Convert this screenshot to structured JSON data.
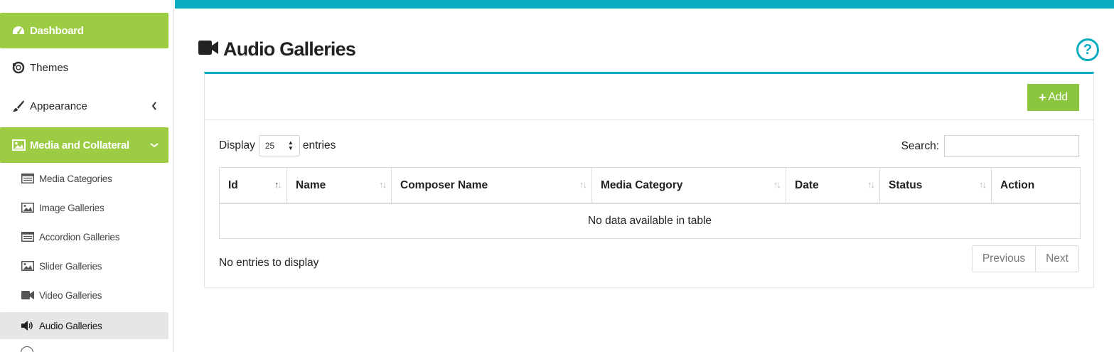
{
  "sidebar": {
    "items": [
      {
        "label": "Dashboard",
        "icon": "dashboard-icon"
      },
      {
        "label": "Themes",
        "icon": "themes-icon"
      },
      {
        "label": "Appearance",
        "icon": "paintbrush-icon"
      },
      {
        "label": "Media and Collateral",
        "icon": "image-icon"
      }
    ],
    "subitems": [
      {
        "label": "Media Categories",
        "icon": "list-icon"
      },
      {
        "label": "Image Galleries",
        "icon": "image-icon"
      },
      {
        "label": "Accordion Galleries",
        "icon": "list-icon"
      },
      {
        "label": "Slider Galleries",
        "icon": "image-icon"
      },
      {
        "label": "Video Galleries",
        "icon": "video-camera-icon"
      },
      {
        "label": "Audio Galleries",
        "icon": "speaker-icon"
      }
    ]
  },
  "header": {
    "title": "Audio Galleries",
    "icon": "video-camera-icon",
    "help_label": "?"
  },
  "toolbar": {
    "add_label": "Add"
  },
  "table_controls": {
    "display_label": "Display",
    "page_size": "25",
    "entries_label": "entries",
    "search_label": "Search:",
    "search_value": ""
  },
  "table": {
    "columns": [
      "Id",
      "Name",
      "Composer Name",
      "Media Category",
      "Date",
      "Status",
      "Action"
    ],
    "empty_message": "No data available in table"
  },
  "footer": {
    "info": "No entries to display",
    "prev_label": "Previous",
    "next_label": "Next"
  },
  "colors": {
    "accent_green": "#9ccc43",
    "teal": "#0aacbf",
    "selected_bg": "#e6e6e6"
  }
}
